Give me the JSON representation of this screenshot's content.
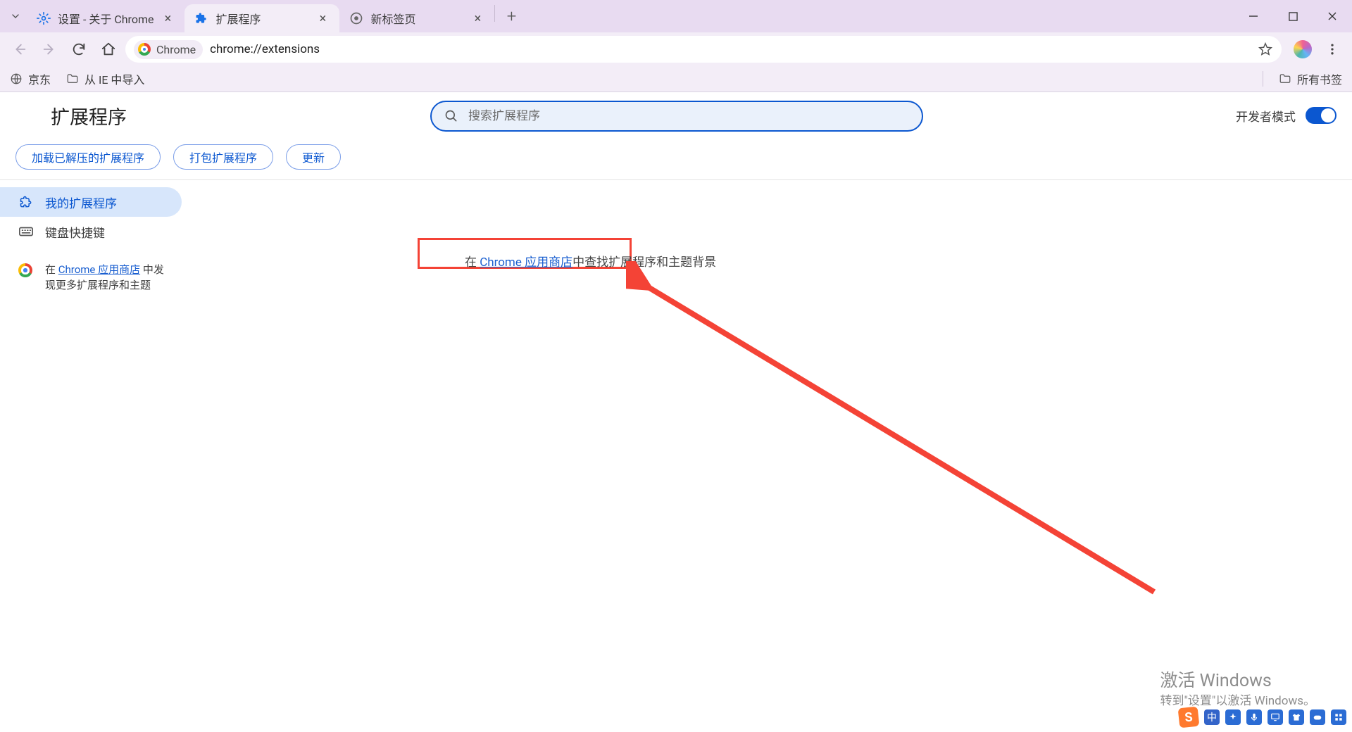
{
  "tabs": [
    {
      "title": "设置 - 关于 Chrome"
    },
    {
      "title": "扩展程序"
    },
    {
      "title": "新标签页"
    }
  ],
  "active_tab_index": 1,
  "omnibox": {
    "chip_label": "Chrome",
    "url": "chrome://extensions"
  },
  "bookmarks": {
    "jd": "京东",
    "ie_import": "从 IE 中导入",
    "all": "所有书签"
  },
  "extensions_page": {
    "title": "扩展程序",
    "search_placeholder": "搜索扩展程序",
    "dev_mode_label": "开发者模式",
    "actions": {
      "load_unpacked": "加载已解压的扩展程序",
      "pack": "打包扩展程序",
      "update": "更新"
    },
    "sidebar": {
      "my_extensions": "我的扩展程序",
      "keyboard_shortcuts": "键盘快捷键",
      "store_hint_prefix": "在 ",
      "store_hint_link": "Chrome 应用商店",
      "store_hint_suffix": " 中发现更多扩展程序和主题"
    },
    "empty_state": {
      "prefix": "在 ",
      "link": "Chrome 应用商店",
      "suffix": "中查找扩展程序和主题背景"
    }
  },
  "watermark": {
    "line1": "激活 Windows",
    "line2": "转到\"设置\"以激活 Windows。"
  },
  "tray": {
    "ime": "中"
  }
}
